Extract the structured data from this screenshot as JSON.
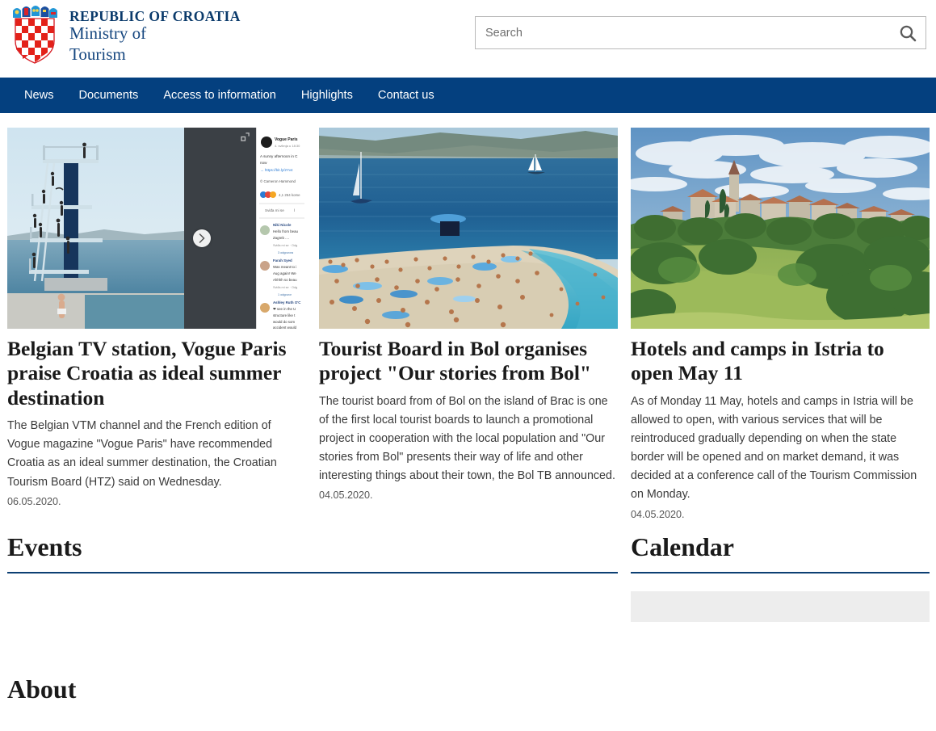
{
  "header": {
    "emblem": "croatia-coat-of-arms",
    "line1": "REPUBLIC OF CROATIA",
    "line2": "Ministry of",
    "line3": "Tourism",
    "search": {
      "placeholder": "Search",
      "value": "",
      "icon": "search-icon"
    }
  },
  "nav": {
    "items": [
      {
        "label": "News"
      },
      {
        "label": "Documents"
      },
      {
        "label": "Access to information"
      },
      {
        "label": "Highlights"
      },
      {
        "label": "Contact us"
      }
    ]
  },
  "cards": [
    {
      "title": "Belgian TV station, Vogue Paris praise Croatia as ideal summer destination",
      "body": "The Belgian VTM channel and the French edition of Vogue magazine \"Vogue Paris\" have recommended Croatia as an ideal summer destination, the Croatian Tourism Board (HTZ) said on Wednesday.",
      "date": "06.05.2020.",
      "image_alt": "Screenshot of a Vogue Paris social media post showing a seaside diving tower with swimmers in Croatia",
      "overlay": {
        "expand_icon": "expand-icon",
        "next_icon": "chevron-right-icon",
        "post_author": "Vogue Paris",
        "post_meta": "4. svibnja u 18:30",
        "post_text": "A sunny afternoon in C",
        "post_text2": "now",
        "post_link": "https://bit.ly/2Yv4",
        "post_credit": "© Cameron Hammond",
        "reactions": "4,1 254 kome",
        "action_like": "Sviđa mi se",
        "comments": [
          {
            "name": "Niki Nicole",
            "text": "Hello from beau Zagreb ...",
            "meta": "Sviđa mi se · Odgo",
            "replies": "3 odgovora"
          },
          {
            "name": "Farah Syed",
            "text": "Was meant to i Aug again! We Ahhhh so beau",
            "meta": "Sviđa mi se · Odgo",
            "replies": "1 odgovor"
          },
          {
            "name": "Ashley Ruth O'C",
            "text": "see in the U structure like t would do som accident would",
            "meta": "",
            "replies": ""
          }
        ]
      }
    },
    {
      "title": "Tourist Board in Bol organises project \"Our stories from Bol\"",
      "body": "The tourist board from of Bol on the island of Brac is one of the first local tourist boards to launch a promotional project in cooperation with the local population and \"Our stories from Bol\" presents their way of life and other interesting things about their town, the Bol TB announced.",
      "date": "04.05.2020.",
      "image_alt": "Crowded Zlatni Rat beach at Bol with sailboats on a blue sea"
    },
    {
      "title": "Hotels and camps in Istria to open May 11",
      "body": "As of Monday 11 May, hotels and camps in Istria will be allowed to open, with various services that will be reintroduced gradually depending on when the state border will be opened and on market demand, it was decided at a conference call of the Tourism Commission on Monday.",
      "date": "04.05.2020.",
      "image_alt": "Istrian hilltop village with church bell tower above green countryside"
    }
  ],
  "sections": {
    "events_title": "Events",
    "calendar_title": "Calendar",
    "about_title": "About"
  },
  "colors": {
    "nav_background": "#04407f",
    "brand_text": "#15467f",
    "rule": "#0c3f73",
    "placeholder": "#ededed"
  }
}
